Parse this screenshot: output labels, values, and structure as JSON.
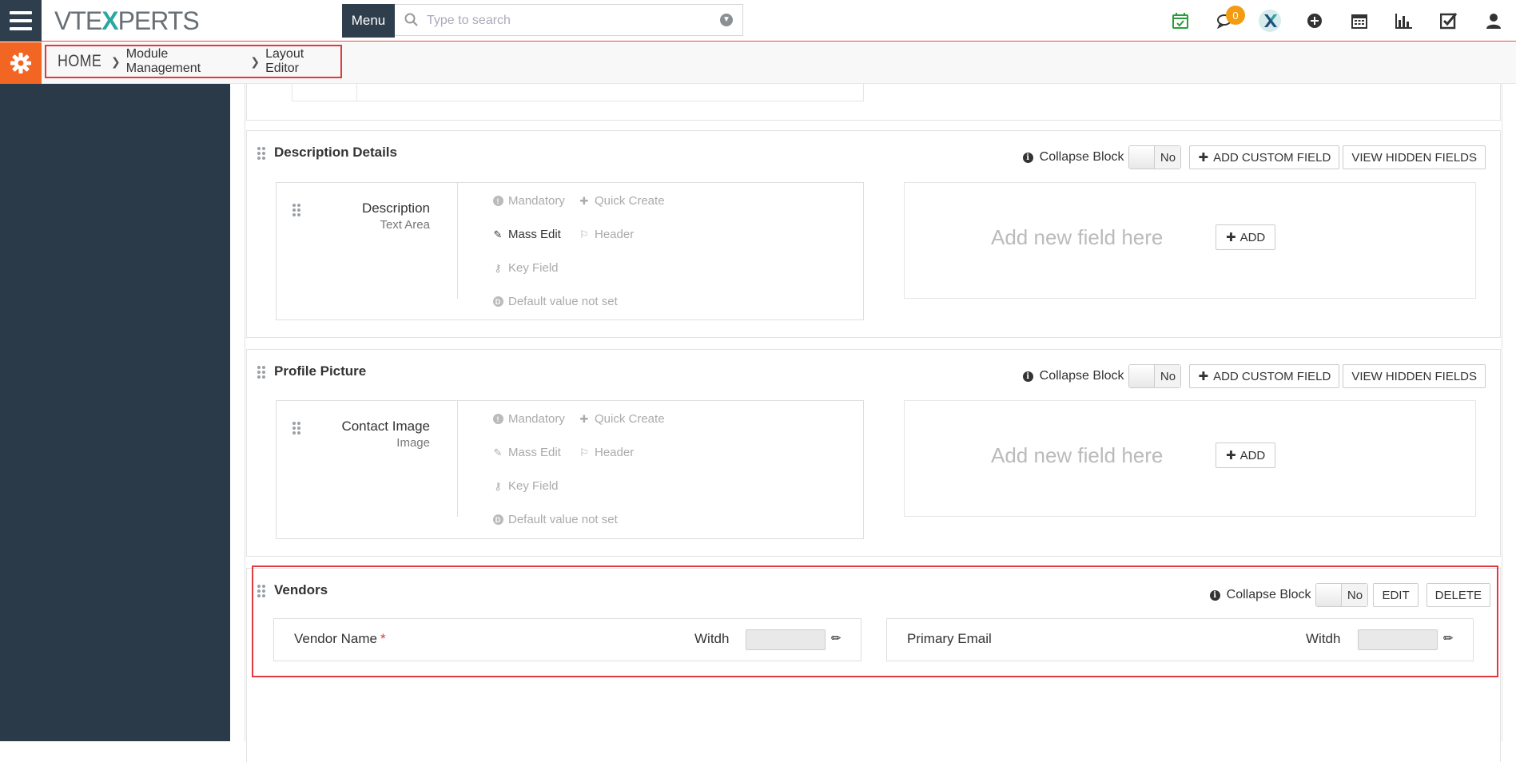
{
  "topbar": {
    "logo_text_left": "VTE",
    "logo_text_x": "X",
    "logo_text_right": "PERTS",
    "menu_label": "Menu",
    "search_placeholder": "Type to search",
    "chat_badge": "0",
    "icons": [
      "calendar-check-icon",
      "chat-icon",
      "vtexperts-x-icon",
      "plus-circle-icon",
      "calendar-icon",
      "bar-chart-icon",
      "checkbox-icon",
      "user-icon"
    ]
  },
  "breadcrumb": {
    "home": "HOME",
    "module_management": "Module Management",
    "layout_editor": "Layout Editor"
  },
  "colors": {
    "accent_orange": "#f26522",
    "sidebar_bg": "#2b3a48",
    "highlight_red": "#e0393e",
    "badge_orange": "#f39c12"
  },
  "common": {
    "collapse_block": "Collapse Block",
    "toggle_no": "No",
    "add_custom_field": "ADD CUSTOM FIELD",
    "view_hidden_fields": "VIEW HIDDEN FIELDS",
    "add_new_field_here": "Add new field here",
    "add": "ADD",
    "mandatory": "Mandatory",
    "quick_create": "Quick Create",
    "mass_edit": "Mass Edit",
    "header": "Header",
    "key_field": "Key Field",
    "default_value": "Default value not set"
  },
  "blocks": {
    "description": {
      "title": "Description Details",
      "field_name": "Description",
      "field_type": "Text Area"
    },
    "profile": {
      "title": "Profile Picture",
      "field_name": "Contact Image",
      "field_type": "Image"
    },
    "vendors": {
      "title": "Vendors",
      "edit": "EDIT",
      "delete": "DELETE",
      "width_label": "Witdh",
      "fields": [
        {
          "label": "Vendor Name",
          "required_mark": "*"
        },
        {
          "label": "Primary Email"
        }
      ]
    }
  }
}
